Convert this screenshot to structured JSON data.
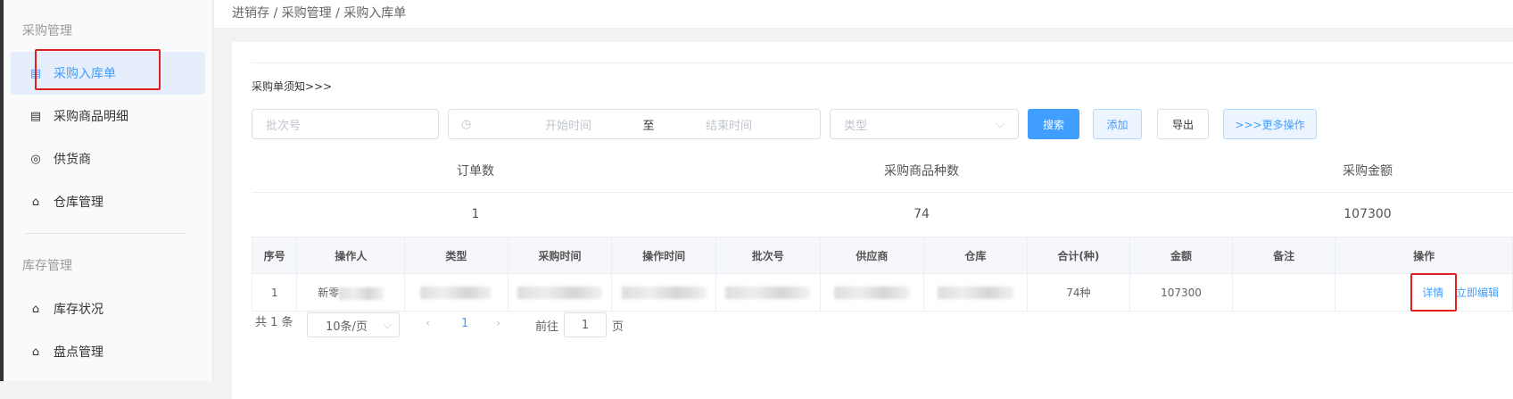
{
  "sidebar": {
    "groups": [
      {
        "title": "采购管理",
        "items": [
          {
            "label": "采购入库单",
            "icon": "document-icon",
            "active": true
          },
          {
            "label": "采购商品明细",
            "icon": "document-list-icon"
          },
          {
            "label": "供货商",
            "icon": "supplier-icon"
          },
          {
            "label": "仓库管理",
            "icon": "house-icon"
          }
        ]
      },
      {
        "title": "库存管理",
        "items": [
          {
            "label": "库存状况",
            "icon": "house-lock-icon"
          },
          {
            "label": "盘点管理",
            "icon": "house-lock-icon"
          }
        ]
      }
    ]
  },
  "breadcrumb": "进销存 / 采购管理 / 采购入库单",
  "notice": "采购单须知>>>",
  "filters": {
    "batch_placeholder": "批次号",
    "start_placeholder": "开始时间",
    "range_sep": "至",
    "end_placeholder": "结束时间",
    "type_placeholder": "类型",
    "search": "搜索",
    "add": "添加",
    "export": "导出",
    "more": ">>>更多操作"
  },
  "stats": {
    "labels": [
      "订单数",
      "采购商品种数",
      "采购金额"
    ],
    "values": [
      "1",
      "74",
      "107300"
    ]
  },
  "table": {
    "headers": [
      "序号",
      "操作人",
      "类型",
      "采购时间",
      "操作时间",
      "批次号",
      "供应商",
      "仓库",
      "合计(种)",
      "金额",
      "备注",
      "操作"
    ],
    "rows": [
      {
        "index": "1",
        "operator": "新零",
        "total": "74种",
        "amount": "107300",
        "remark": "",
        "actions": [
          "详情",
          "立即编辑"
        ]
      }
    ]
  },
  "pagination": {
    "total": "共 1 条",
    "page_size": "10条/页",
    "current": "1",
    "goto_label": "前往",
    "goto_value": "1",
    "page_unit": "页"
  },
  "colors": {
    "primary": "#409eff",
    "annotation": "#e02020"
  }
}
